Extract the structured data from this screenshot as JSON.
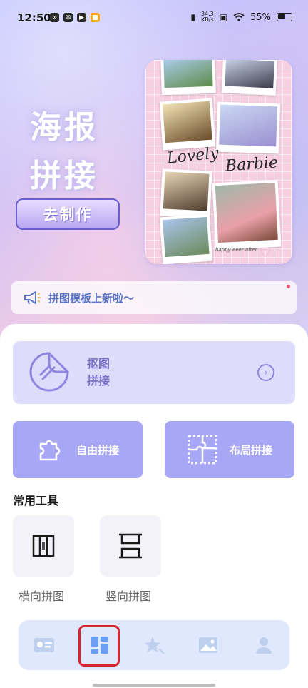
{
  "status_bar": {
    "time": "12:50",
    "net_speed_value": "34.3",
    "net_speed_unit": "KB/s",
    "battery": "55%"
  },
  "hero": {
    "title_line1": "海报",
    "title_line2": "拼接",
    "make_button": "去制作",
    "poster": {
      "text_lovely": "Lovely",
      "text_barbie": "Barbie",
      "text_small": "happy ever after"
    }
  },
  "notice": {
    "text": "拼图模板上新啦～",
    "icon": "megaphone-icon"
  },
  "cutout_card": {
    "line1": "抠图",
    "line2": "拼接",
    "icon": "sticker-icon",
    "arrow_icon": "chevron-right-circle-icon"
  },
  "tiles": [
    {
      "label": "自由拼接",
      "icon": "puzzle-piece-icon"
    },
    {
      "label": "布局拼接",
      "icon": "puzzle-layout-icon"
    }
  ],
  "common_tools": {
    "title": "常用工具",
    "items": [
      {
        "label": "横向拼图",
        "icon": "horizontal-stitch-icon"
      },
      {
        "label": "竖向拼图",
        "icon": "vertical-stitch-icon"
      }
    ]
  },
  "bottom_nav": {
    "items": [
      {
        "name": "card",
        "icon": "id-card-icon"
      },
      {
        "name": "layout",
        "icon": "grid-layout-icon",
        "active": true
      },
      {
        "name": "effects",
        "icon": "sparkle-star-icon"
      },
      {
        "name": "gallery",
        "icon": "image-icon"
      },
      {
        "name": "profile",
        "icon": "person-icon"
      }
    ]
  },
  "colors": {
    "accent": "#a7a7f6",
    "cutout_bg": "#dedcfb",
    "active_frame": "#d8242e",
    "nav_bg": "#dfe8fc"
  }
}
